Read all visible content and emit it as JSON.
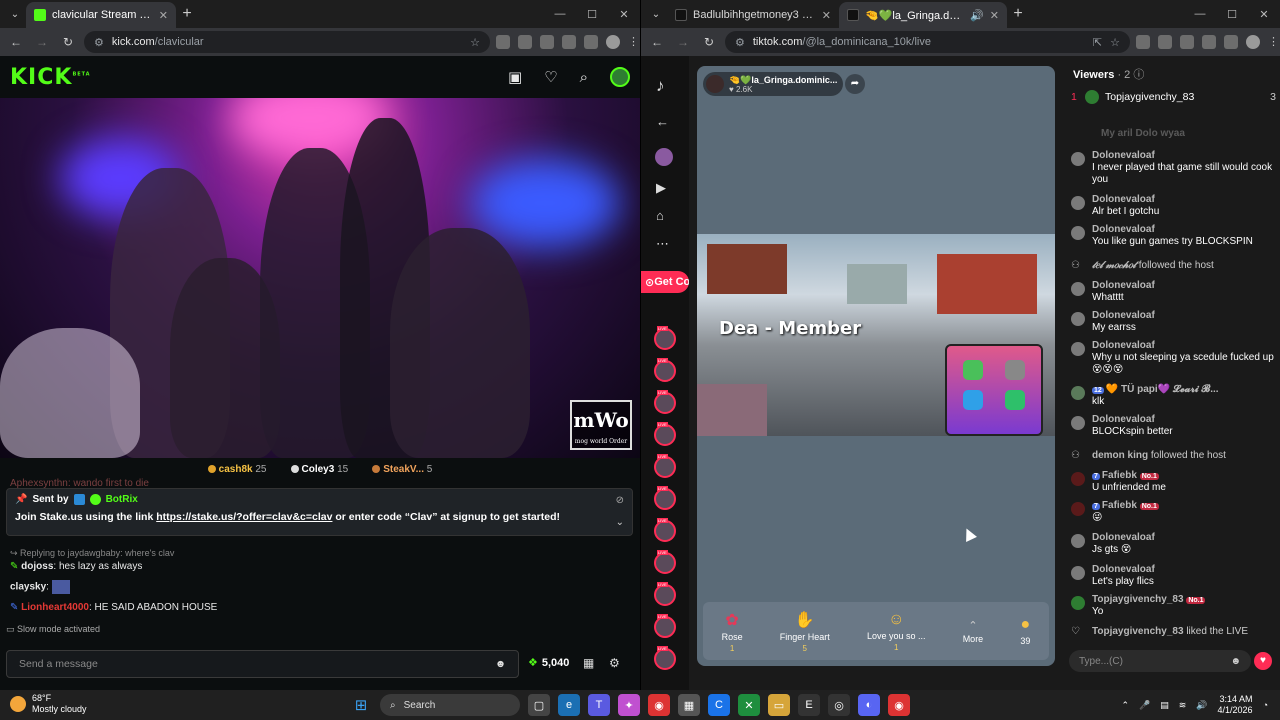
{
  "left_window": {
    "tab_title": "clavicular Stream - Watch Live o",
    "url_host": "kick.com",
    "url_path": "/clavicular",
    "kick": {
      "logo": "KICK",
      "logo_beta": "BETA",
      "watermark": "mWo",
      "watermark_sub": "mog world Order",
      "top_supporters": [
        {
          "name": "cash8k",
          "count": "25"
        },
        {
          "name": "Coley3",
          "count": "15"
        },
        {
          "name": "SteakV...",
          "count": "5"
        }
      ],
      "cutoff_line": "Aphexsynthn: wando first to die",
      "pinned": {
        "sent_by": "Sent by",
        "bot": "BotRix",
        "message_pre": "Join Stake.us using the link ",
        "link": "https://stake.us/?offer=clav&c=clav",
        "message_post": " or enter code “Clav” at signup to get started!"
      },
      "reply_to": "Replying to jaydawgbaby: where's clav",
      "messages": [
        {
          "user": "dojoss",
          "text": "hes lazy as always",
          "color": "#ffffff"
        },
        {
          "user": "claysky",
          "text": "",
          "color": "#ffffff"
        },
        {
          "user": "Lionheart4000",
          "text": "HE SAID ABADON HOUSE",
          "color": "#e53935"
        }
      ],
      "slow_mode": "Slow mode activated",
      "send_placeholder": "Send a message",
      "points": "5,040"
    }
  },
  "right_window": {
    "tabs": [
      {
        "title": "Badlulbihhgetmoney3 (@badlu"
      },
      {
        "title": "🤏💚la_Gringa.dominicana"
      }
    ],
    "url_host": "tiktok.com",
    "url_path": "/@la_dominicana_10k/live",
    "tiktok": {
      "get_coins": "Get Coins",
      "host_name": "🤏💚la_Gringa.dominic...",
      "host_likes": "2.6K",
      "game_text": "Dea - Member",
      "gifts": [
        {
          "name": "Rose",
          "price": "1",
          "icon": "rose-icon"
        },
        {
          "name": "Finger Heart",
          "price": "5",
          "icon": "finger-heart-icon"
        },
        {
          "name": "Love you so ...",
          "price": "1",
          "icon": "love-face-icon"
        },
        {
          "name": "More",
          "price": "",
          "icon": "chevron-up-icon"
        },
        {
          "name": "39",
          "price": "",
          "icon": "coin-icon"
        }
      ],
      "viewers_label": "Viewers",
      "viewers_count": "· 2",
      "top_viewer": {
        "rank": "1",
        "name": "Topjaygivenchy_83",
        "count": "3"
      },
      "chat": [
        {
          "user": "My aril Dolo wyaa",
          "text": "",
          "type": "cut"
        },
        {
          "user": "Dolonevaloaf",
          "text": "I never played that game still would cook you"
        },
        {
          "user": "Dolonevaloaf",
          "text": "Alr bet I gotchu"
        },
        {
          "user": "Dolonevaloaf",
          "text": "You like gun games try BLOCKSPIN"
        },
        {
          "user": "𝓉𝑒𝓁 𝓂𝑜𝒸𝒽𝑜𝓉",
          "text": "followed the host",
          "type": "sys"
        },
        {
          "user": "Dolonevaloaf",
          "text": "Whatttt"
        },
        {
          "user": "Dolonevaloaf",
          "text": "My earrss"
        },
        {
          "user": "Dolonevaloaf",
          "text": "Why u not sleeping ya scedule fucked up😵😵😵"
        },
        {
          "user": "🧡 TÜ papi💜 𝓛𝓮𝓪𝓻𝓲 𝓑...",
          "text": "klk",
          "badge": "12"
        },
        {
          "user": "Dolonevaloaf",
          "text": "BLOCKspin better"
        },
        {
          "user": "demon king",
          "text": "followed the host",
          "type": "sys"
        },
        {
          "user": "Fafiebk",
          "text": "U unfriended me",
          "badge": "7",
          "no1": "No.1"
        },
        {
          "user": "Fafiebk",
          "text": "😜",
          "badge": "7",
          "no1": "No.1"
        },
        {
          "user": "Dolonevaloaf",
          "text": "Js gts 😵"
        },
        {
          "user": "Dolonevaloaf",
          "text": "Let's play flics"
        },
        {
          "user": "Topjaygivenchy_83",
          "text": "Yo",
          "no1": "No.1"
        },
        {
          "user": "Topjaygivenchy_83",
          "text": "liked the LIVE",
          "type": "sys"
        }
      ],
      "type_placeholder": "Type...(C)"
    }
  },
  "taskbar": {
    "temp": "68°F",
    "weather": "Mostly cloudy",
    "search": "Search",
    "time": "3:14 AM",
    "date": "4/1/2026"
  }
}
